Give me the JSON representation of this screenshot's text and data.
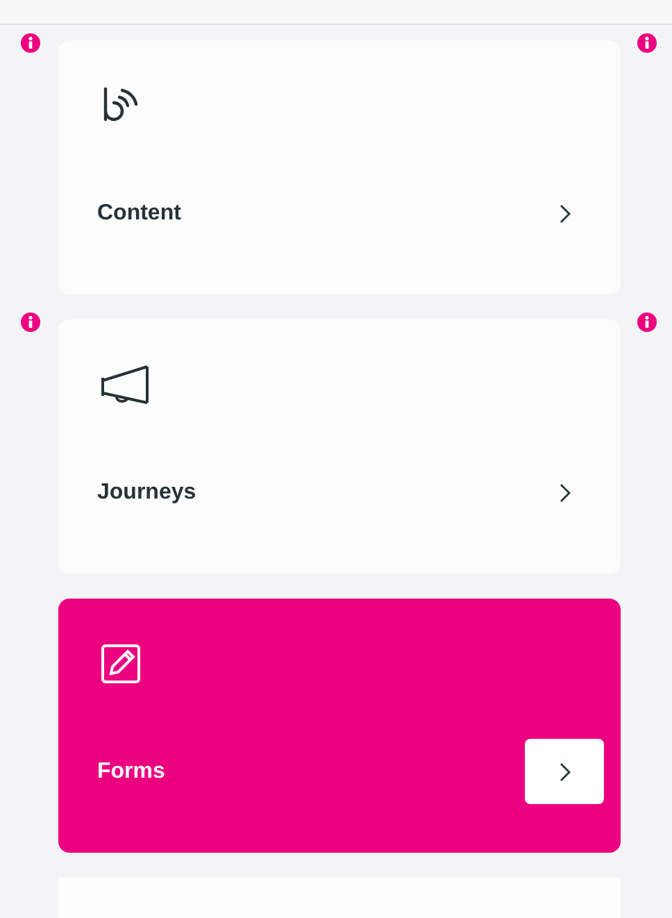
{
  "cards": [
    {
      "label": "Content",
      "kind": "content",
      "selected": false,
      "info": true
    },
    {
      "label": "Journeys",
      "kind": "journeys",
      "selected": false,
      "info": true
    },
    {
      "label": "Forms",
      "kind": "forms",
      "selected": true,
      "info": false
    }
  ]
}
